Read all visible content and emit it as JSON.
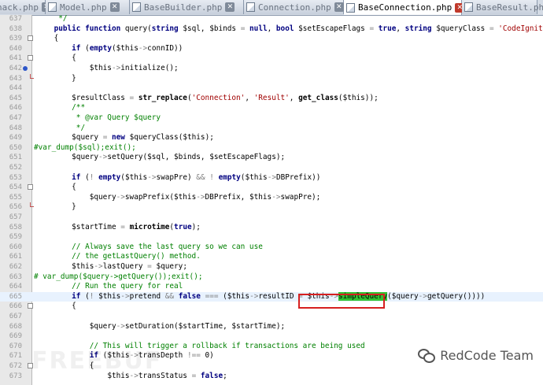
{
  "tabs": [
    {
      "label": "hack.php",
      "active": false
    },
    {
      "label": "Model.php",
      "active": false
    },
    {
      "label": "BaseBuilder.php",
      "active": false
    },
    {
      "label": "Connection.php",
      "active": false
    },
    {
      "label": "BaseConnection.php",
      "active": true
    },
    {
      "label": "BaseResult.php",
      "active": false
    }
  ],
  "lines": [
    {
      "n": "637",
      "code": "     */",
      "indent": 0
    },
    {
      "n": "638",
      "code": "    public function query(string $sql, $binds = null, bool $setEscapeFlags = true, string $queryClass = 'CodeIgniter\\\\Database\\\\Query')",
      "indent": 0
    },
    {
      "n": "639",
      "code": "    {",
      "indent": 0
    },
    {
      "n": "640",
      "code": "        if (empty($this->connID))",
      "indent": 0
    },
    {
      "n": "641",
      "code": "        {",
      "indent": 0
    },
    {
      "n": "642",
      "code": "            $this->initialize();",
      "indent": 0
    },
    {
      "n": "643",
      "code": "        }",
      "indent": 0
    },
    {
      "n": "644",
      "code": "",
      "indent": 0
    },
    {
      "n": "645",
      "code": "        $resultClass = str_replace('Connection', 'Result', get_class($this));",
      "indent": 0
    },
    {
      "n": "646",
      "code": "        /**",
      "indent": 0
    },
    {
      "n": "647",
      "code": "         * @var Query $query",
      "indent": 0
    },
    {
      "n": "648",
      "code": "         */",
      "indent": 0
    },
    {
      "n": "649",
      "code": "        $query = new $queryClass($this);",
      "indent": 0
    },
    {
      "n": "650",
      "code": "#var_dump($sql);exit();",
      "indent": 1
    },
    {
      "n": "651",
      "code": "        $query->setQuery($sql, $binds, $setEscapeFlags);",
      "indent": 0
    },
    {
      "n": "652",
      "code": "",
      "indent": 0
    },
    {
      "n": "653",
      "code": "        if (! empty($this->swapPre) && ! empty($this->DBPrefix))",
      "indent": 0
    },
    {
      "n": "654",
      "code": "        {",
      "indent": 0
    },
    {
      "n": "655",
      "code": "            $query->swapPrefix($this->DBPrefix, $this->swapPre);",
      "indent": 0
    },
    {
      "n": "656",
      "code": "        }",
      "indent": 0
    },
    {
      "n": "657",
      "code": "",
      "indent": 0
    },
    {
      "n": "658",
      "code": "        $startTime = microtime(true);",
      "indent": 0
    },
    {
      "n": "659",
      "code": "",
      "indent": 0
    },
    {
      "n": "660",
      "code": "        // Always save the last query so we can use",
      "indent": 0
    },
    {
      "n": "661",
      "code": "        // the getLastQuery() method.",
      "indent": 0
    },
    {
      "n": "662",
      "code": "        $this->lastQuery = $query;",
      "indent": 0
    },
    {
      "n": "663",
      "code": "# var_dump($query->getQuery());exit();",
      "indent": 1
    },
    {
      "n": "664",
      "code": "        // Run the query for real",
      "indent": 0
    },
    {
      "n": "665",
      "code": "        if (! $this->pretend && false === ($this->resultID = $this->simpleQuery($query->getQuery())))",
      "indent": 0
    },
    {
      "n": "666",
      "code": "        {",
      "indent": 0
    },
    {
      "n": "667",
      "code": "",
      "indent": 0
    },
    {
      "n": "668",
      "code": "            $query->setDuration($startTime, $startTime);",
      "indent": 0
    },
    {
      "n": "669",
      "code": "",
      "indent": 0
    },
    {
      "n": "670",
      "code": "            // This will trigger a rollback if transactions are being used",
      "indent": 0
    },
    {
      "n": "671",
      "code": "            if ($this->transDepth !== 0)",
      "indent": 0
    },
    {
      "n": "672",
      "code": "            {",
      "indent": 0
    },
    {
      "n": "673",
      "code": "                $this->transStatus = false;",
      "indent": 0
    }
  ],
  "highlight_line": "665",
  "selected_text": "simpleQuery",
  "watermark": {
    "text": "RedCode Team",
    "faint": "FREEBUF"
  },
  "colors": {
    "keyword": "#000080",
    "string": "#a00000",
    "comment": "#008000",
    "selection": "#33c233",
    "annotation_box": "#d62020",
    "current_line": "#e8f2fe"
  }
}
